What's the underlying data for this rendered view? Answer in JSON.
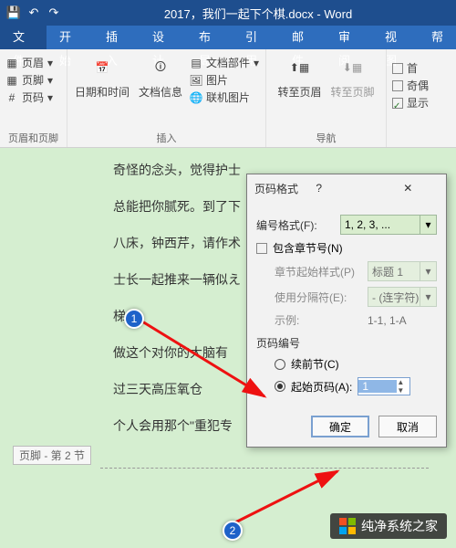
{
  "titlebar": {
    "doc_title": "2017，我们一起下个棋.docx - Word"
  },
  "menubar": {
    "file": "文件",
    "tabs": [
      "开始",
      "插入",
      "设计",
      "布局",
      "引用",
      "邮件",
      "审阅",
      "视图",
      "帮"
    ]
  },
  "ribbon": {
    "hdrftr": {
      "header": "页眉",
      "footer": "页脚",
      "pagenum": "页码",
      "label": "页眉和页脚"
    },
    "insert": {
      "datetime": "日期和时间",
      "docinfo": "文档信息",
      "docparts": "文档部件",
      "pictures": "图片",
      "online": "联机图片",
      "label": "插入"
    },
    "nav": {
      "goto_header": "转至页眉",
      "goto_footer": "转至页脚",
      "label": "导航"
    },
    "opts": {
      "diff_even_odd": "奇偶",
      "show": "显示"
    }
  },
  "document": {
    "lines": [
      "奇怪的念头，觉得护士",
      "总能把你腻死。到了下",
      "八床，钟西芹，请作术",
      "士长一起推来一辆似え",
      "梯",
      "做这个对你的大脑有",
      "过三天高压氧仓",
      "个人会用那个\"重犯专"
    ],
    "footer_label": "页脚 - 第 2 节"
  },
  "dialog": {
    "title": "页码格式",
    "num_format_lbl": "编号格式(F):",
    "num_format_val": "1, 2, 3, ...",
    "include_chapter": "包含章节号(N)",
    "chapter_style_lbl": "章节起始样式(P)",
    "chapter_style_val": "标题 1",
    "separator_lbl": "使用分隔符(E):",
    "separator_val": "- (连字符)",
    "example_lbl": "示例:",
    "example_val": "1-1, 1-A",
    "pagenum_group": "页码编号",
    "continue": "续前节(C)",
    "start_at": "起始页码(A):",
    "start_val": "1",
    "ok": "确定",
    "cancel": "取消"
  },
  "markers": {
    "one": "1",
    "two": "2"
  },
  "watermark": "纯净系统之家"
}
